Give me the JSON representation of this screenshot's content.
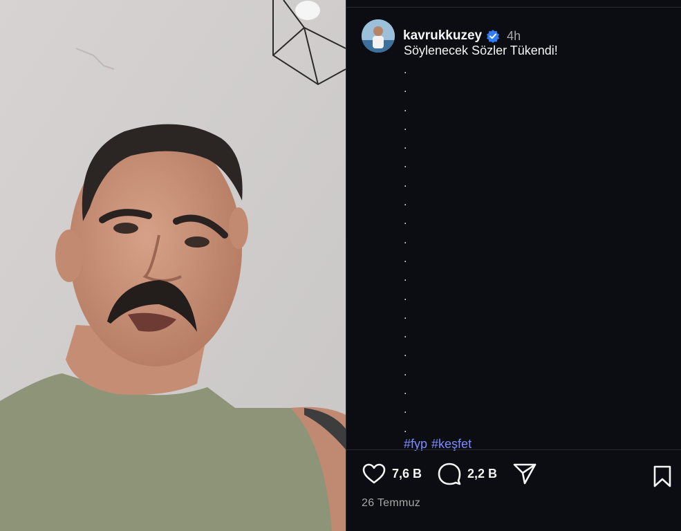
{
  "post": {
    "username": "kavrukkuzey",
    "time": "4h",
    "caption_title": "Söylenecek Sözler Tükendi!",
    "caption_dots": [
      ".",
      ".",
      ".",
      ".",
      ".",
      ".",
      ".",
      ".",
      ".",
      ".",
      ".",
      ".",
      ".",
      ".",
      ".",
      ".",
      ".",
      ".",
      ".",
      "."
    ],
    "hashtags": [
      "#fyp",
      "#keşfet"
    ],
    "likes": "7,6 B",
    "comments": "2,2 B",
    "date": "26 Temmuz"
  },
  "colors": {
    "background": "#0b0d12",
    "hashtag": "#7c8cff",
    "verified": "#2f7cf6",
    "muted": "#a8a8a8"
  },
  "icons": {
    "verified": "verified-badge-icon",
    "like": "heart-icon",
    "comment": "comment-bubble-icon",
    "share": "paper-plane-icon",
    "save": "bookmark-icon"
  }
}
